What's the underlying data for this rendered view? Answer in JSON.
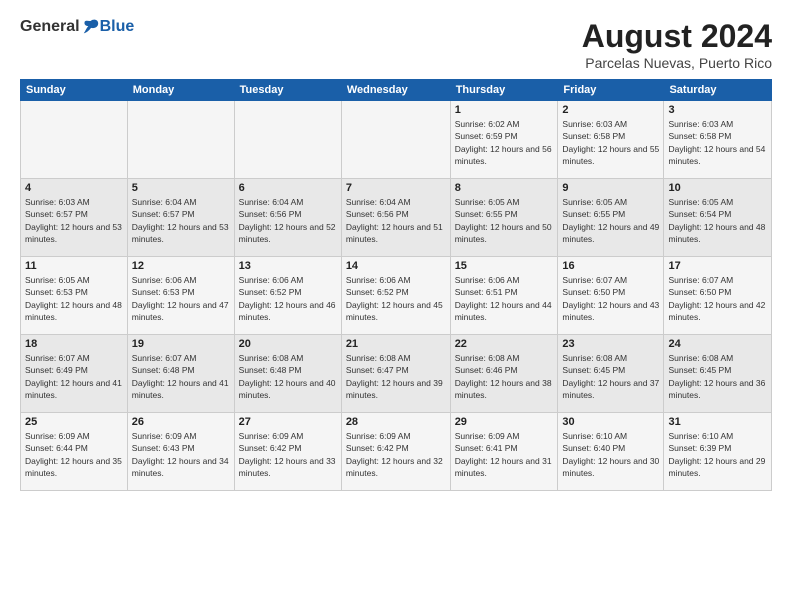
{
  "logo": {
    "general": "General",
    "blue": "Blue",
    "tagline": ""
  },
  "header": {
    "title": "August 2024",
    "subtitle": "Parcelas Nuevas, Puerto Rico"
  },
  "weekdays": [
    "Sunday",
    "Monday",
    "Tuesday",
    "Wednesday",
    "Thursday",
    "Friday",
    "Saturday"
  ],
  "weeks": [
    [
      {
        "day": "",
        "sunrise": "",
        "sunset": "",
        "daylight": ""
      },
      {
        "day": "",
        "sunrise": "",
        "sunset": "",
        "daylight": ""
      },
      {
        "day": "",
        "sunrise": "",
        "sunset": "",
        "daylight": ""
      },
      {
        "day": "",
        "sunrise": "",
        "sunset": "",
        "daylight": ""
      },
      {
        "day": "1",
        "sunrise": "Sunrise: 6:02 AM",
        "sunset": "Sunset: 6:59 PM",
        "daylight": "Daylight: 12 hours and 56 minutes."
      },
      {
        "day": "2",
        "sunrise": "Sunrise: 6:03 AM",
        "sunset": "Sunset: 6:58 PM",
        "daylight": "Daylight: 12 hours and 55 minutes."
      },
      {
        "day": "3",
        "sunrise": "Sunrise: 6:03 AM",
        "sunset": "Sunset: 6:58 PM",
        "daylight": "Daylight: 12 hours and 54 minutes."
      }
    ],
    [
      {
        "day": "4",
        "sunrise": "Sunrise: 6:03 AM",
        "sunset": "Sunset: 6:57 PM",
        "daylight": "Daylight: 12 hours and 53 minutes."
      },
      {
        "day": "5",
        "sunrise": "Sunrise: 6:04 AM",
        "sunset": "Sunset: 6:57 PM",
        "daylight": "Daylight: 12 hours and 53 minutes."
      },
      {
        "day": "6",
        "sunrise": "Sunrise: 6:04 AM",
        "sunset": "Sunset: 6:56 PM",
        "daylight": "Daylight: 12 hours and 52 minutes."
      },
      {
        "day": "7",
        "sunrise": "Sunrise: 6:04 AM",
        "sunset": "Sunset: 6:56 PM",
        "daylight": "Daylight: 12 hours and 51 minutes."
      },
      {
        "day": "8",
        "sunrise": "Sunrise: 6:05 AM",
        "sunset": "Sunset: 6:55 PM",
        "daylight": "Daylight: 12 hours and 50 minutes."
      },
      {
        "day": "9",
        "sunrise": "Sunrise: 6:05 AM",
        "sunset": "Sunset: 6:55 PM",
        "daylight": "Daylight: 12 hours and 49 minutes."
      },
      {
        "day": "10",
        "sunrise": "Sunrise: 6:05 AM",
        "sunset": "Sunset: 6:54 PM",
        "daylight": "Daylight: 12 hours and 48 minutes."
      }
    ],
    [
      {
        "day": "11",
        "sunrise": "Sunrise: 6:05 AM",
        "sunset": "Sunset: 6:53 PM",
        "daylight": "Daylight: 12 hours and 48 minutes."
      },
      {
        "day": "12",
        "sunrise": "Sunrise: 6:06 AM",
        "sunset": "Sunset: 6:53 PM",
        "daylight": "Daylight: 12 hours and 47 minutes."
      },
      {
        "day": "13",
        "sunrise": "Sunrise: 6:06 AM",
        "sunset": "Sunset: 6:52 PM",
        "daylight": "Daylight: 12 hours and 46 minutes."
      },
      {
        "day": "14",
        "sunrise": "Sunrise: 6:06 AM",
        "sunset": "Sunset: 6:52 PM",
        "daylight": "Daylight: 12 hours and 45 minutes."
      },
      {
        "day": "15",
        "sunrise": "Sunrise: 6:06 AM",
        "sunset": "Sunset: 6:51 PM",
        "daylight": "Daylight: 12 hours and 44 minutes."
      },
      {
        "day": "16",
        "sunrise": "Sunrise: 6:07 AM",
        "sunset": "Sunset: 6:50 PM",
        "daylight": "Daylight: 12 hours and 43 minutes."
      },
      {
        "day": "17",
        "sunrise": "Sunrise: 6:07 AM",
        "sunset": "Sunset: 6:50 PM",
        "daylight": "Daylight: 12 hours and 42 minutes."
      }
    ],
    [
      {
        "day": "18",
        "sunrise": "Sunrise: 6:07 AM",
        "sunset": "Sunset: 6:49 PM",
        "daylight": "Daylight: 12 hours and 41 minutes."
      },
      {
        "day": "19",
        "sunrise": "Sunrise: 6:07 AM",
        "sunset": "Sunset: 6:48 PM",
        "daylight": "Daylight: 12 hours and 41 minutes."
      },
      {
        "day": "20",
        "sunrise": "Sunrise: 6:08 AM",
        "sunset": "Sunset: 6:48 PM",
        "daylight": "Daylight: 12 hours and 40 minutes."
      },
      {
        "day": "21",
        "sunrise": "Sunrise: 6:08 AM",
        "sunset": "Sunset: 6:47 PM",
        "daylight": "Daylight: 12 hours and 39 minutes."
      },
      {
        "day": "22",
        "sunrise": "Sunrise: 6:08 AM",
        "sunset": "Sunset: 6:46 PM",
        "daylight": "Daylight: 12 hours and 38 minutes."
      },
      {
        "day": "23",
        "sunrise": "Sunrise: 6:08 AM",
        "sunset": "Sunset: 6:45 PM",
        "daylight": "Daylight: 12 hours and 37 minutes."
      },
      {
        "day": "24",
        "sunrise": "Sunrise: 6:08 AM",
        "sunset": "Sunset: 6:45 PM",
        "daylight": "Daylight: 12 hours and 36 minutes."
      }
    ],
    [
      {
        "day": "25",
        "sunrise": "Sunrise: 6:09 AM",
        "sunset": "Sunset: 6:44 PM",
        "daylight": "Daylight: 12 hours and 35 minutes."
      },
      {
        "day": "26",
        "sunrise": "Sunrise: 6:09 AM",
        "sunset": "Sunset: 6:43 PM",
        "daylight": "Daylight: 12 hours and 34 minutes."
      },
      {
        "day": "27",
        "sunrise": "Sunrise: 6:09 AM",
        "sunset": "Sunset: 6:42 PM",
        "daylight": "Daylight: 12 hours and 33 minutes."
      },
      {
        "day": "28",
        "sunrise": "Sunrise: 6:09 AM",
        "sunset": "Sunset: 6:42 PM",
        "daylight": "Daylight: 12 hours and 32 minutes."
      },
      {
        "day": "29",
        "sunrise": "Sunrise: 6:09 AM",
        "sunset": "Sunset: 6:41 PM",
        "daylight": "Daylight: 12 hours and 31 minutes."
      },
      {
        "day": "30",
        "sunrise": "Sunrise: 6:10 AM",
        "sunset": "Sunset: 6:40 PM",
        "daylight": "Daylight: 12 hours and 30 minutes."
      },
      {
        "day": "31",
        "sunrise": "Sunrise: 6:10 AM",
        "sunset": "Sunset: 6:39 PM",
        "daylight": "Daylight: 12 hours and 29 minutes."
      }
    ]
  ]
}
